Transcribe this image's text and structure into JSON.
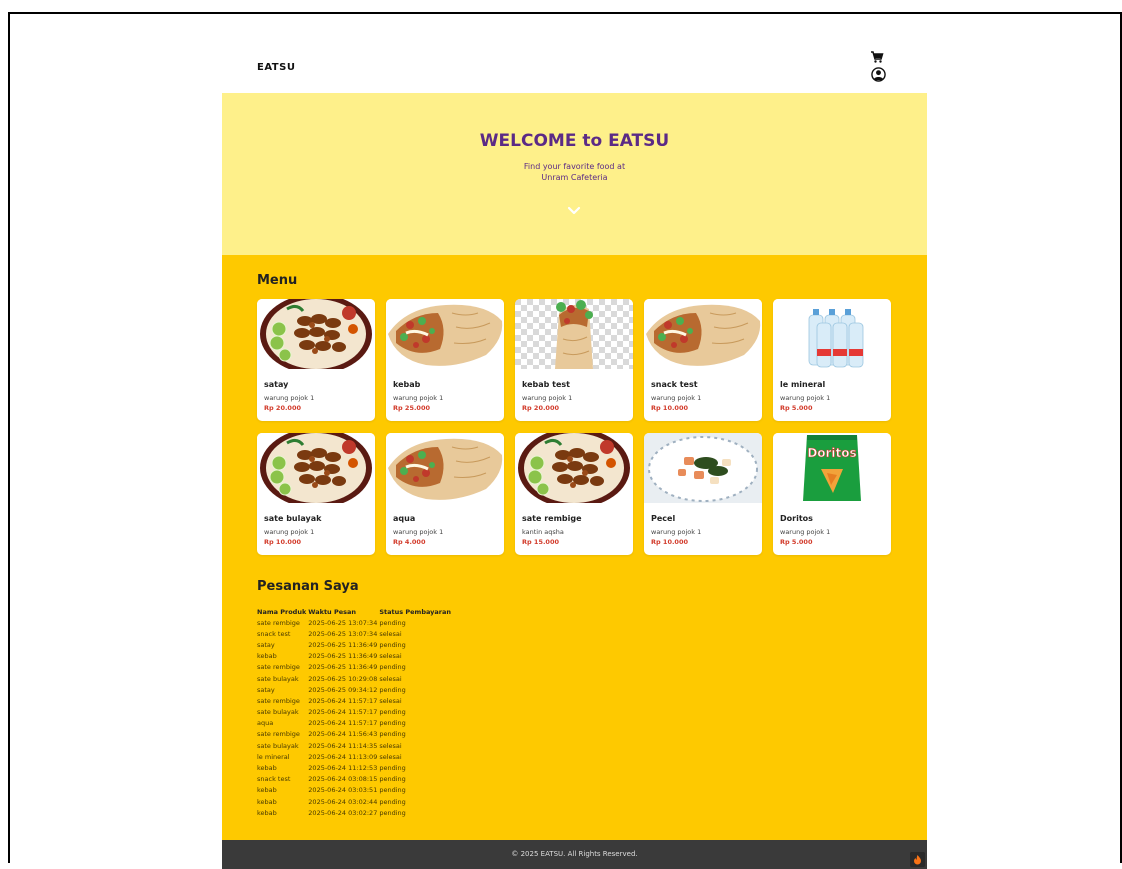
{
  "header": {
    "brand": "EATSU",
    "cart_icon": "cart-icon",
    "profile_icon": "user-circle-icon"
  },
  "hero": {
    "title": "WELCOME to EATSU",
    "subtitle_line1": "Find your favorite food at",
    "subtitle_line2": "Unram Cafeteria",
    "scroll_icon": "chevron-down-icon"
  },
  "menu": {
    "title": "Menu",
    "items": [
      {
        "name": "satay",
        "vendor": "warung pojok 1",
        "price": "Rp 20.000",
        "image": "satay"
      },
      {
        "name": "kebab",
        "vendor": "warung pojok 1",
        "price": "Rp 25.000",
        "image": "wrap"
      },
      {
        "name": "kebab test",
        "vendor": "warung pojok 1",
        "price": "Rp 20.000",
        "image": "wrap-transparent"
      },
      {
        "name": "snack test",
        "vendor": "warung pojok 1",
        "price": "Rp 10.000",
        "image": "wrap"
      },
      {
        "name": "le mineral",
        "vendor": "warung pojok 1",
        "price": "Rp 5.000",
        "image": "water-bottles"
      },
      {
        "name": "sate bulayak",
        "vendor": "warung pojok 1",
        "price": "Rp 10.000",
        "image": "satay"
      },
      {
        "name": "aqua",
        "vendor": "warung pojok 1",
        "price": "Rp 4.000",
        "image": "wrap"
      },
      {
        "name": "sate rembige",
        "vendor": "kantin aqsha",
        "price": "Rp 15.000",
        "image": "satay"
      },
      {
        "name": "Pecel",
        "vendor": "warung pojok 1",
        "price": "Rp 10.000",
        "image": "pecel-plate"
      },
      {
        "name": "Doritos",
        "vendor": "warung pojok 1",
        "price": "Rp 5.000",
        "image": "doritos-bag",
        "logo_text": "Doritos"
      }
    ]
  },
  "orders": {
    "title": "Pesanan Saya",
    "columns": [
      "Nama Produk",
      "Waktu Pesan",
      "Status Pembayaran"
    ],
    "rows": [
      [
        "sate rembige",
        "2025-06-25 13:07:34",
        "pending"
      ],
      [
        "snack test",
        "2025-06-25 13:07:34",
        "selesai"
      ],
      [
        "satay",
        "2025-06-25 11:36:49",
        "pending"
      ],
      [
        "kebab",
        "2025-06-25 11:36:49",
        "selesai"
      ],
      [
        "sate rembige",
        "2025-06-25 11:36:49",
        "pending"
      ],
      [
        "sate bulayak",
        "2025-06-25 10:29:08",
        "selesai"
      ],
      [
        "satay",
        "2025-06-25 09:34:12",
        "pending"
      ],
      [
        "sate rembige",
        "2025-06-24 11:57:17",
        "selesai"
      ],
      [
        "sate bulayak",
        "2025-06-24 11:57:17",
        "pending"
      ],
      [
        "aqua",
        "2025-06-24 11:57:17",
        "pending"
      ],
      [
        "sate rembige",
        "2025-06-24 11:56:43",
        "pending"
      ],
      [
        "sate bulayak",
        "2025-06-24 11:14:35",
        "selesai"
      ],
      [
        "le mineral",
        "2025-06-24 11:13:09",
        "selesai"
      ],
      [
        "kebab",
        "2025-06-24 11:12:53",
        "pending"
      ],
      [
        "snack test",
        "2025-06-24 03:08:15",
        "pending"
      ],
      [
        "kebab",
        "2025-06-24 03:03:51",
        "pending"
      ],
      [
        "kebab",
        "2025-06-24 03:02:44",
        "pending"
      ],
      [
        "kebab",
        "2025-06-24 03:02:27",
        "pending"
      ]
    ]
  },
  "footer": {
    "copyright": "© 2025 EATSU. All Rights Reserved.",
    "fab_icon": "flame-icon"
  },
  "colors": {
    "hero_bg": "#fef08a",
    "main_bg": "#fec900",
    "title_purple": "#5b2a86",
    "price_red": "#d23a2a",
    "footer_bg": "#3a3a3a"
  }
}
